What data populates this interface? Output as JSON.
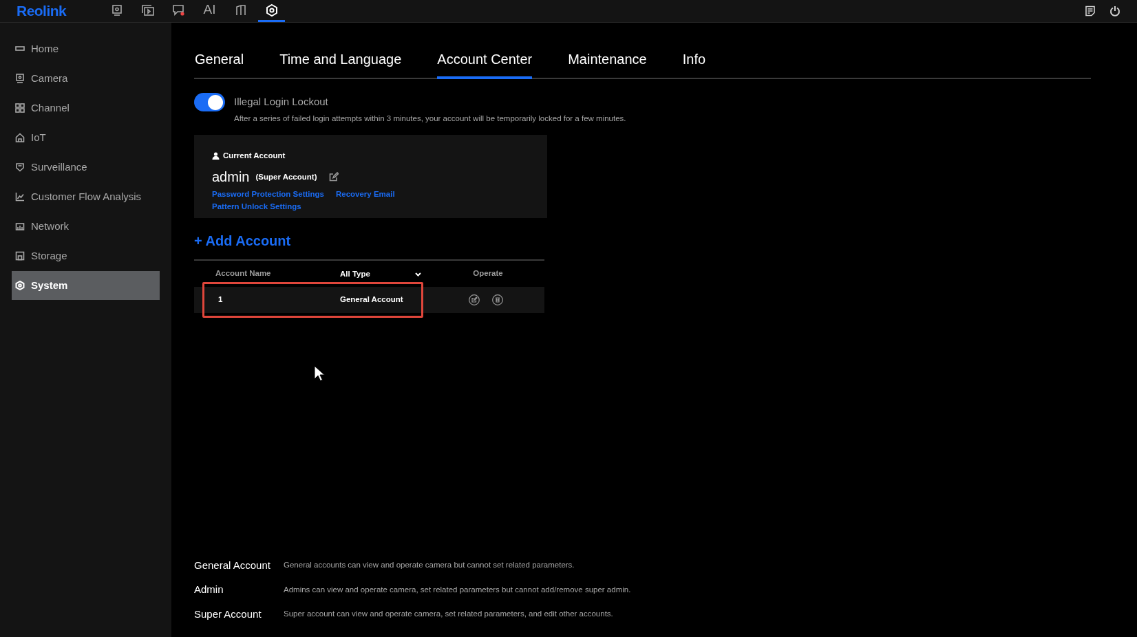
{
  "top_bar": {
    "logo": "Reolink",
    "nav": [
      {
        "kind": "camera",
        "selected": false
      },
      {
        "kind": "playback",
        "selected": false
      },
      {
        "kind": "alerts",
        "selected": false
      },
      {
        "kind": "text",
        "label": "AI",
        "selected": false
      },
      {
        "kind": "device",
        "selected": false
      },
      {
        "kind": "settings",
        "selected": true
      }
    ]
  },
  "sidebar": {
    "items": [
      {
        "label": "Home",
        "selected": false
      },
      {
        "label": "Camera",
        "selected": false
      },
      {
        "label": "Channel",
        "selected": false
      },
      {
        "label": "IoT",
        "selected": false
      },
      {
        "label": "Surveillance",
        "selected": false
      },
      {
        "label": "Customer Flow Analysis",
        "selected": false
      },
      {
        "label": "Network",
        "selected": false
      },
      {
        "label": "Storage",
        "selected": false
      },
      {
        "label": "System",
        "selected": true
      }
    ]
  },
  "tabs": [
    {
      "label": "General",
      "selected": false
    },
    {
      "label": "Time and Language",
      "selected": false
    },
    {
      "label": "Account Center",
      "selected": true
    },
    {
      "label": "Maintenance",
      "selected": false
    },
    {
      "label": "Info",
      "selected": false
    }
  ],
  "lockout": {
    "label": "Illegal Login Lockout",
    "on": true,
    "description": "After a series of failed login attempts within 3 minutes, your account will be temporarily locked for a few minutes."
  },
  "current_account": {
    "heading": "Current Account",
    "name": "admin",
    "role": "(Super Account)",
    "links": [
      "Password Protection Settings",
      "Recovery Email",
      "Pattern Unlock Settings"
    ]
  },
  "add_account": "+ Add Account",
  "table": {
    "columns": [
      "Account Name",
      "All Type",
      "Operate"
    ],
    "rows": [
      {
        "name": "1",
        "type": "General Account",
        "highlighted": true
      }
    ]
  },
  "legend": [
    {
      "term": "General Account",
      "description": "General accounts can view and operate camera but cannot set related parameters."
    },
    {
      "term": "Admin",
      "description": "Admins can view and operate camera, set related parameters but cannot add/remove super admin."
    },
    {
      "term": "Super Account",
      "description": "Super account can view and operate camera, set related parameters, and edit other accounts."
    }
  ]
}
